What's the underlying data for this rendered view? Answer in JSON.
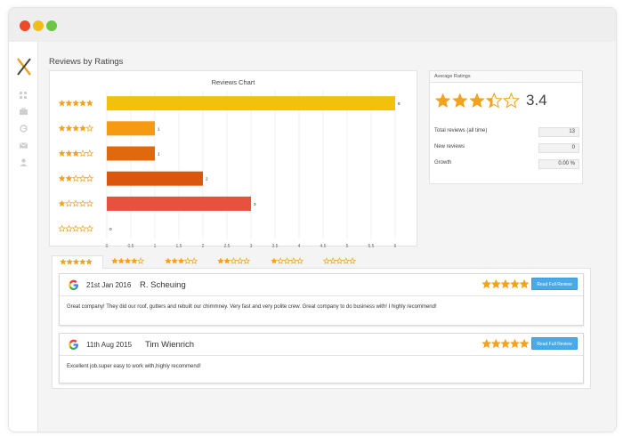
{
  "window": {
    "traffic_lights": [
      "red",
      "yellow",
      "green"
    ]
  },
  "sidebar": {
    "logo": "x-logo-icon",
    "icons": [
      "grid-icon",
      "briefcase-icon",
      "chart-icon",
      "mail-icon",
      "user-icon"
    ]
  },
  "section_title": "Reviews by Ratings",
  "chart_data": {
    "type": "bar",
    "orientation": "horizontal",
    "title": "Reviews Chart",
    "categories": [
      "5 stars",
      "4 stars",
      "3 stars",
      "2 stars",
      "1 star",
      "0 stars"
    ],
    "star_counts": [
      5,
      4,
      3,
      2,
      1,
      0
    ],
    "values": [
      6,
      1,
      1,
      2,
      3,
      0
    ],
    "value_labels": [
      "6",
      "1",
      "1",
      "2",
      "3",
      "0"
    ],
    "colors": [
      "#f2c10c",
      "#f59a12",
      "#e0690e",
      "#d9570c",
      "#e8503f",
      "#cccccc"
    ],
    "xlim": [
      0,
      6
    ],
    "xticks": [
      "0",
      "0.5",
      "1",
      "1.5",
      "2",
      "2.5",
      "3",
      "3.5",
      "4",
      "4.5",
      "5",
      "5.5",
      "6"
    ],
    "grid": true,
    "star_color": "#f2a21c"
  },
  "average": {
    "header": "Average Ratings",
    "rating_value": "3.4",
    "rating": 3.4,
    "rows": [
      {
        "label": "Total reviews (all time)",
        "value": "13"
      },
      {
        "label": "New reviews",
        "value": "0"
      },
      {
        "label": "Growth",
        "value": "0.00 %"
      }
    ]
  },
  "tabs": [
    {
      "stars": 5,
      "active": true
    },
    {
      "stars": 4,
      "active": false
    },
    {
      "stars": 3,
      "active": false
    },
    {
      "stars": 2,
      "active": false
    },
    {
      "stars": 1,
      "active": false
    },
    {
      "stars": 0,
      "active": false
    }
  ],
  "reviews": [
    {
      "date": "21st Jan 2016",
      "name": "R. Scheuing",
      "stars": 5,
      "button": "Read Full Review",
      "text": "Great company! They did our roof, gutters and rebuilt our chimmney. Very fast and very polite crew. Great company to do business with! I highly recommend!"
    },
    {
      "date": "11th Aug 2015",
      "name": "Tim Wienrich",
      "stars": 5,
      "button": "Read Full Review",
      "text": "Excellent job.super easy to work with,highly recommend!"
    }
  ],
  "colors": {
    "star": "#f2a21c",
    "button": "#4aa9e8",
    "panel_bg": "#f4f4f4"
  }
}
